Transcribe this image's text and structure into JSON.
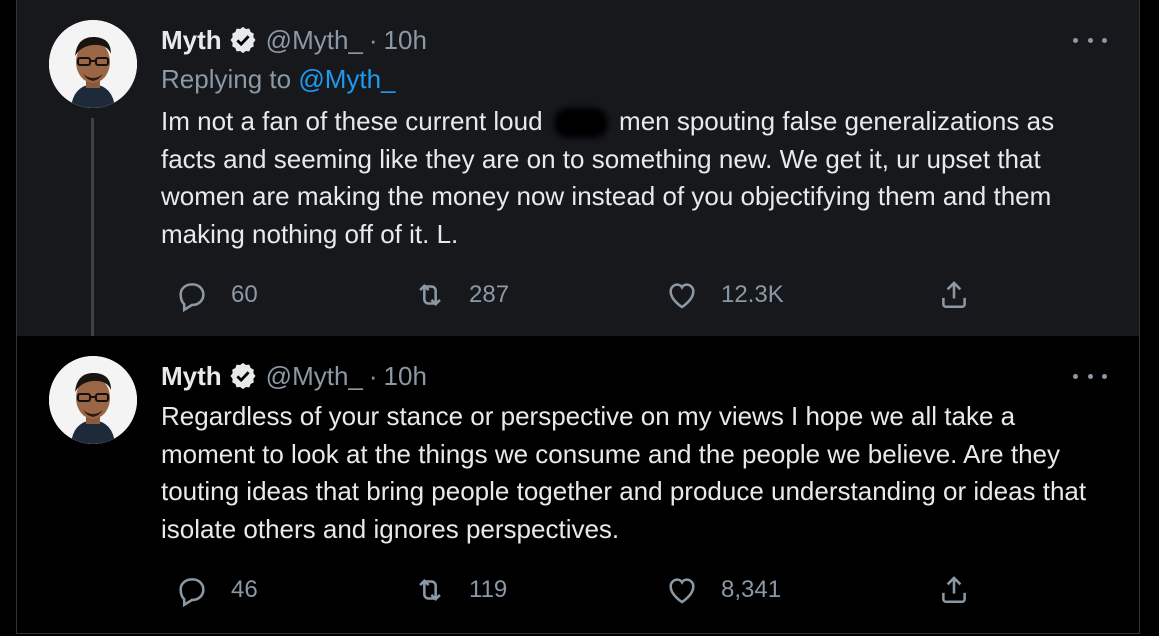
{
  "tweets": [
    {
      "name": "Myth",
      "handle": "@Myth_",
      "separator": "·",
      "time": "10h",
      "replying_prefix": "Replying to",
      "replying_to": "@Myth_",
      "text_before_redaction": "Im not a fan of these current loud",
      "text_after_redaction": "men spouting false generalizations as facts and seeming like they are on to something new. We get it, ur upset that women are making the money now instead of you objectifying them and them making nothing off of it. L.",
      "replies": "60",
      "retweets": "287",
      "likes": "12.3K"
    },
    {
      "name": "Myth",
      "handle": "@Myth_",
      "separator": "·",
      "time": "10h",
      "text": "Regardless of your stance or perspective on my views I hope we all take a moment to look at the things we consume and the people we believe. Are they touting ideas that bring people together and produce understanding or ideas that isolate others and ignores perspectives.",
      "replies": "46",
      "retweets": "119",
      "likes": "8,341"
    }
  ],
  "colors": {
    "background": "#000000",
    "highlight_background": "#16181c",
    "text": "#e7e9ea",
    "secondary": "#8b98a5",
    "link": "#1d9bf0"
  },
  "icons": [
    "verified-badge-icon",
    "more-icon",
    "reply-icon",
    "retweet-icon",
    "like-icon",
    "share-icon"
  ]
}
